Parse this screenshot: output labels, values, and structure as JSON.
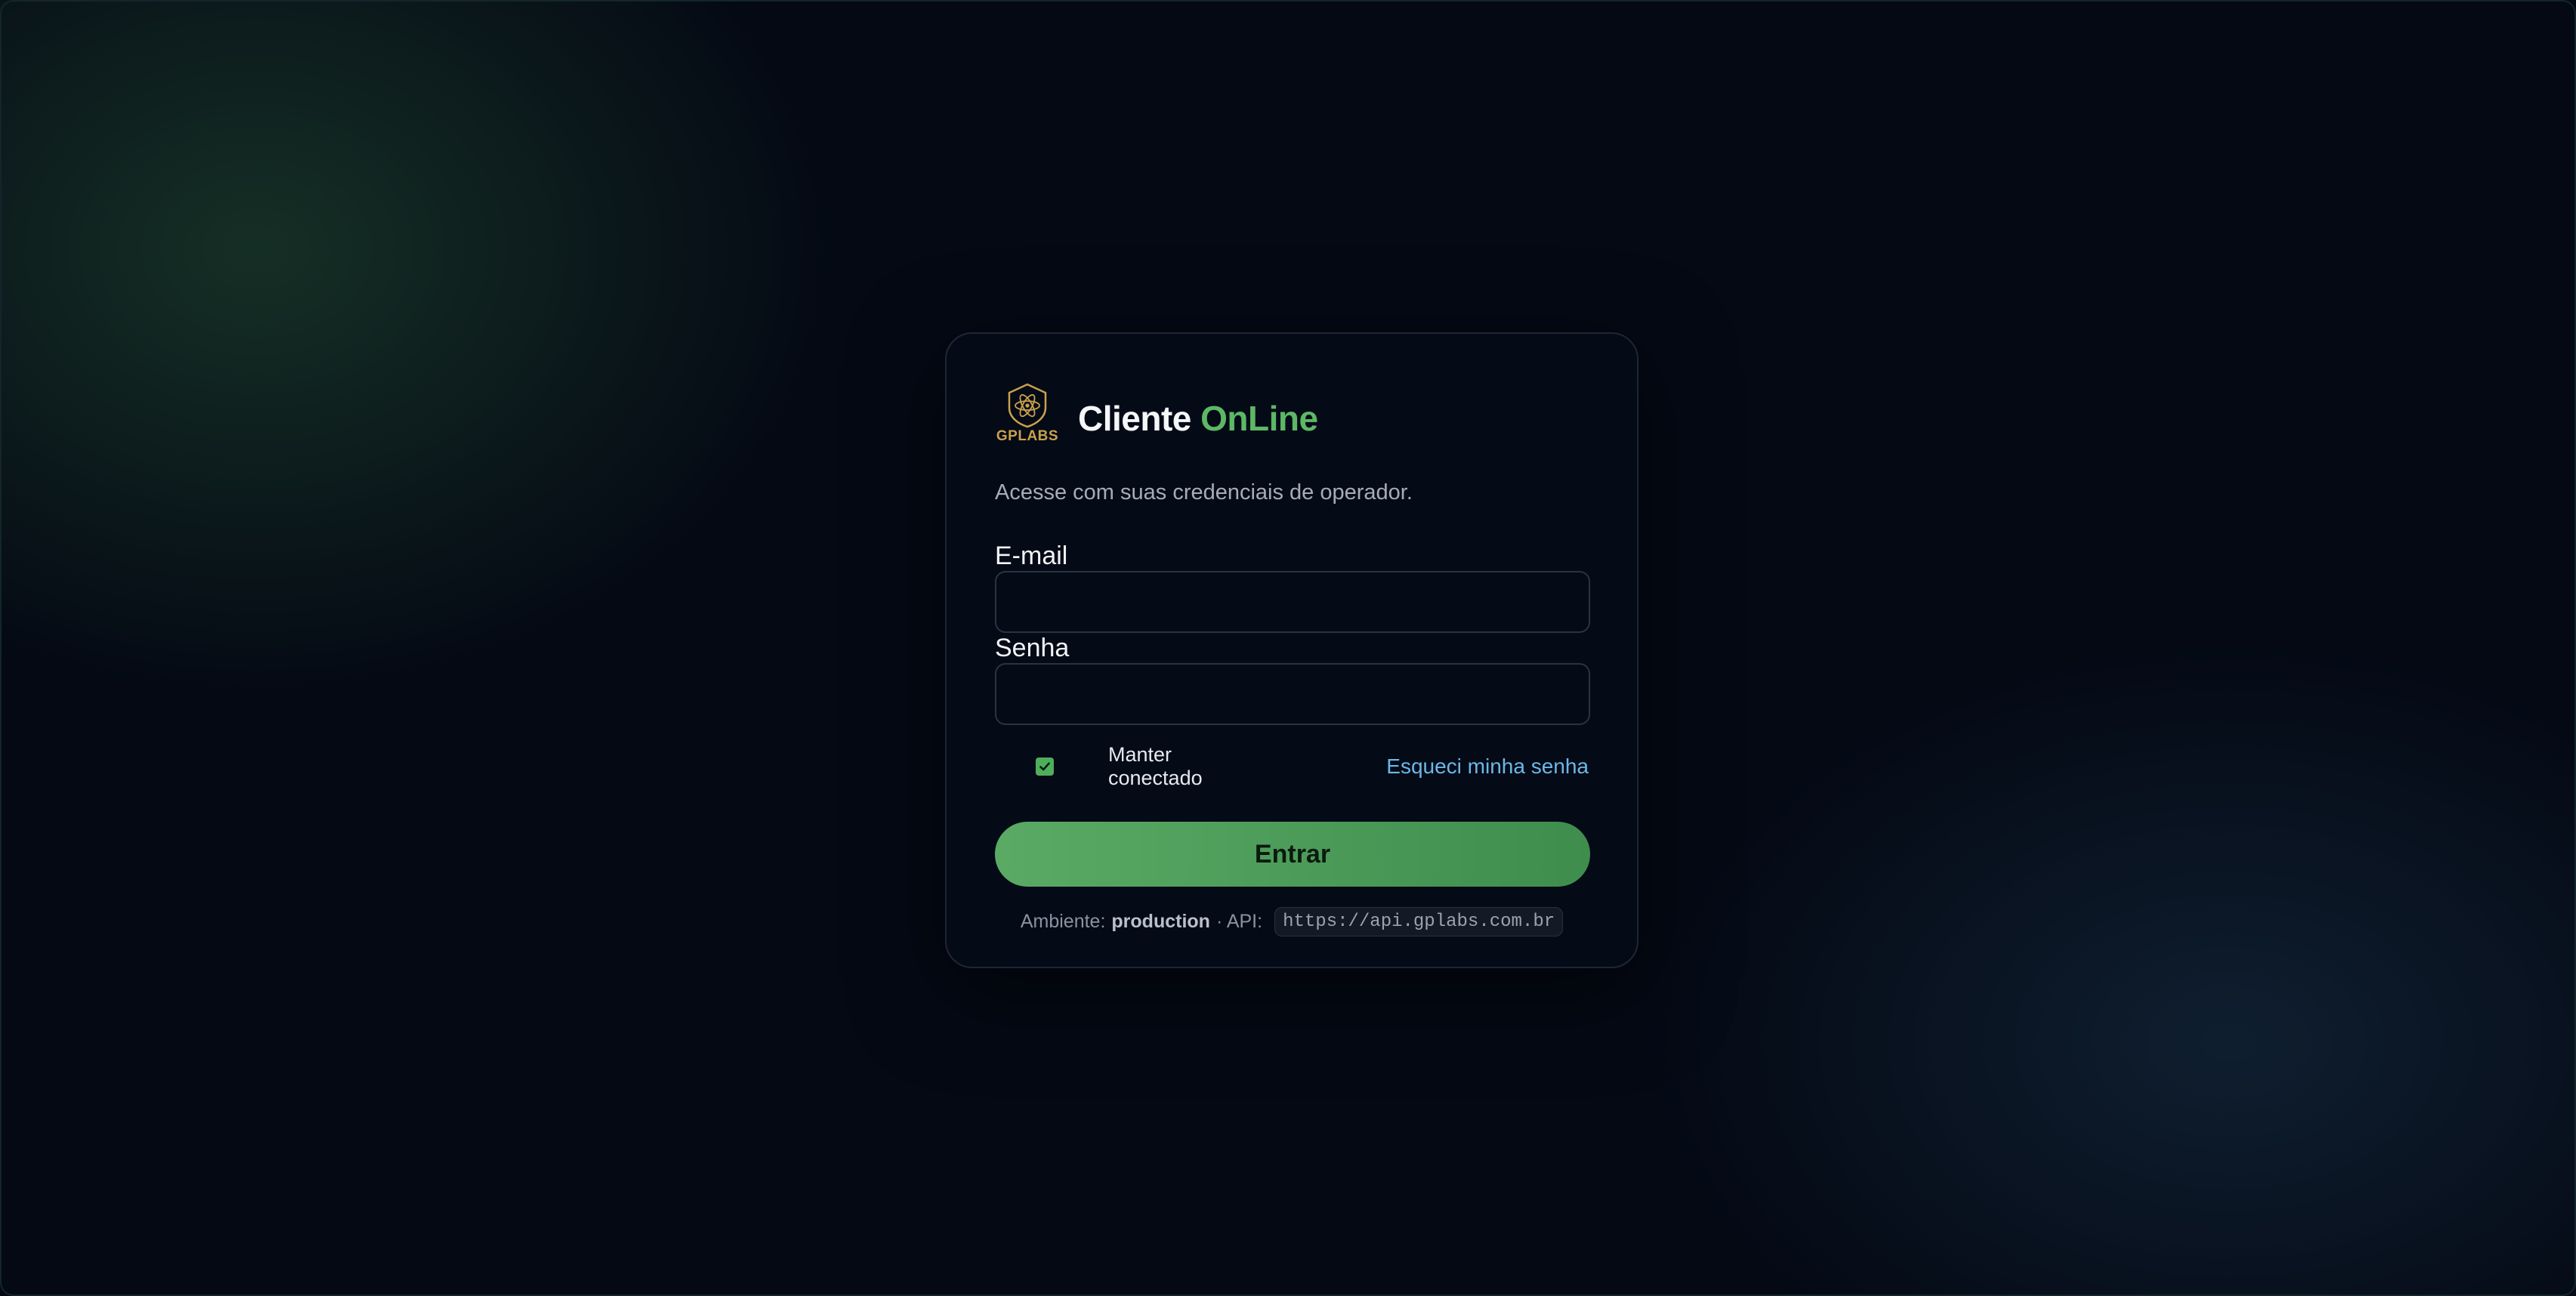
{
  "brand": {
    "logo_text": "GPLABS",
    "title_main": "Cliente",
    "title_accent": "OnLine",
    "accent_color": "#5cb865"
  },
  "form": {
    "subtitle": "Acesse com suas credenciais de operador.",
    "email": {
      "label": "E-mail",
      "value": "",
      "placeholder": ""
    },
    "password": {
      "label": "Senha",
      "value": "",
      "placeholder": ""
    },
    "remember": {
      "label": "Manter conectado",
      "checked": true
    },
    "forgot_label": "Esqueci minha senha",
    "submit_label": "Entrar"
  },
  "footer": {
    "env_prefix": "Ambiente:",
    "env_value": "production",
    "api_prefix": "· API:",
    "api_url": "https://api.gplabs.com.br"
  },
  "colors": {
    "background": "#040914",
    "button": "#52a05e",
    "link": "#6bb8e8",
    "logo": "#c9a24a"
  }
}
